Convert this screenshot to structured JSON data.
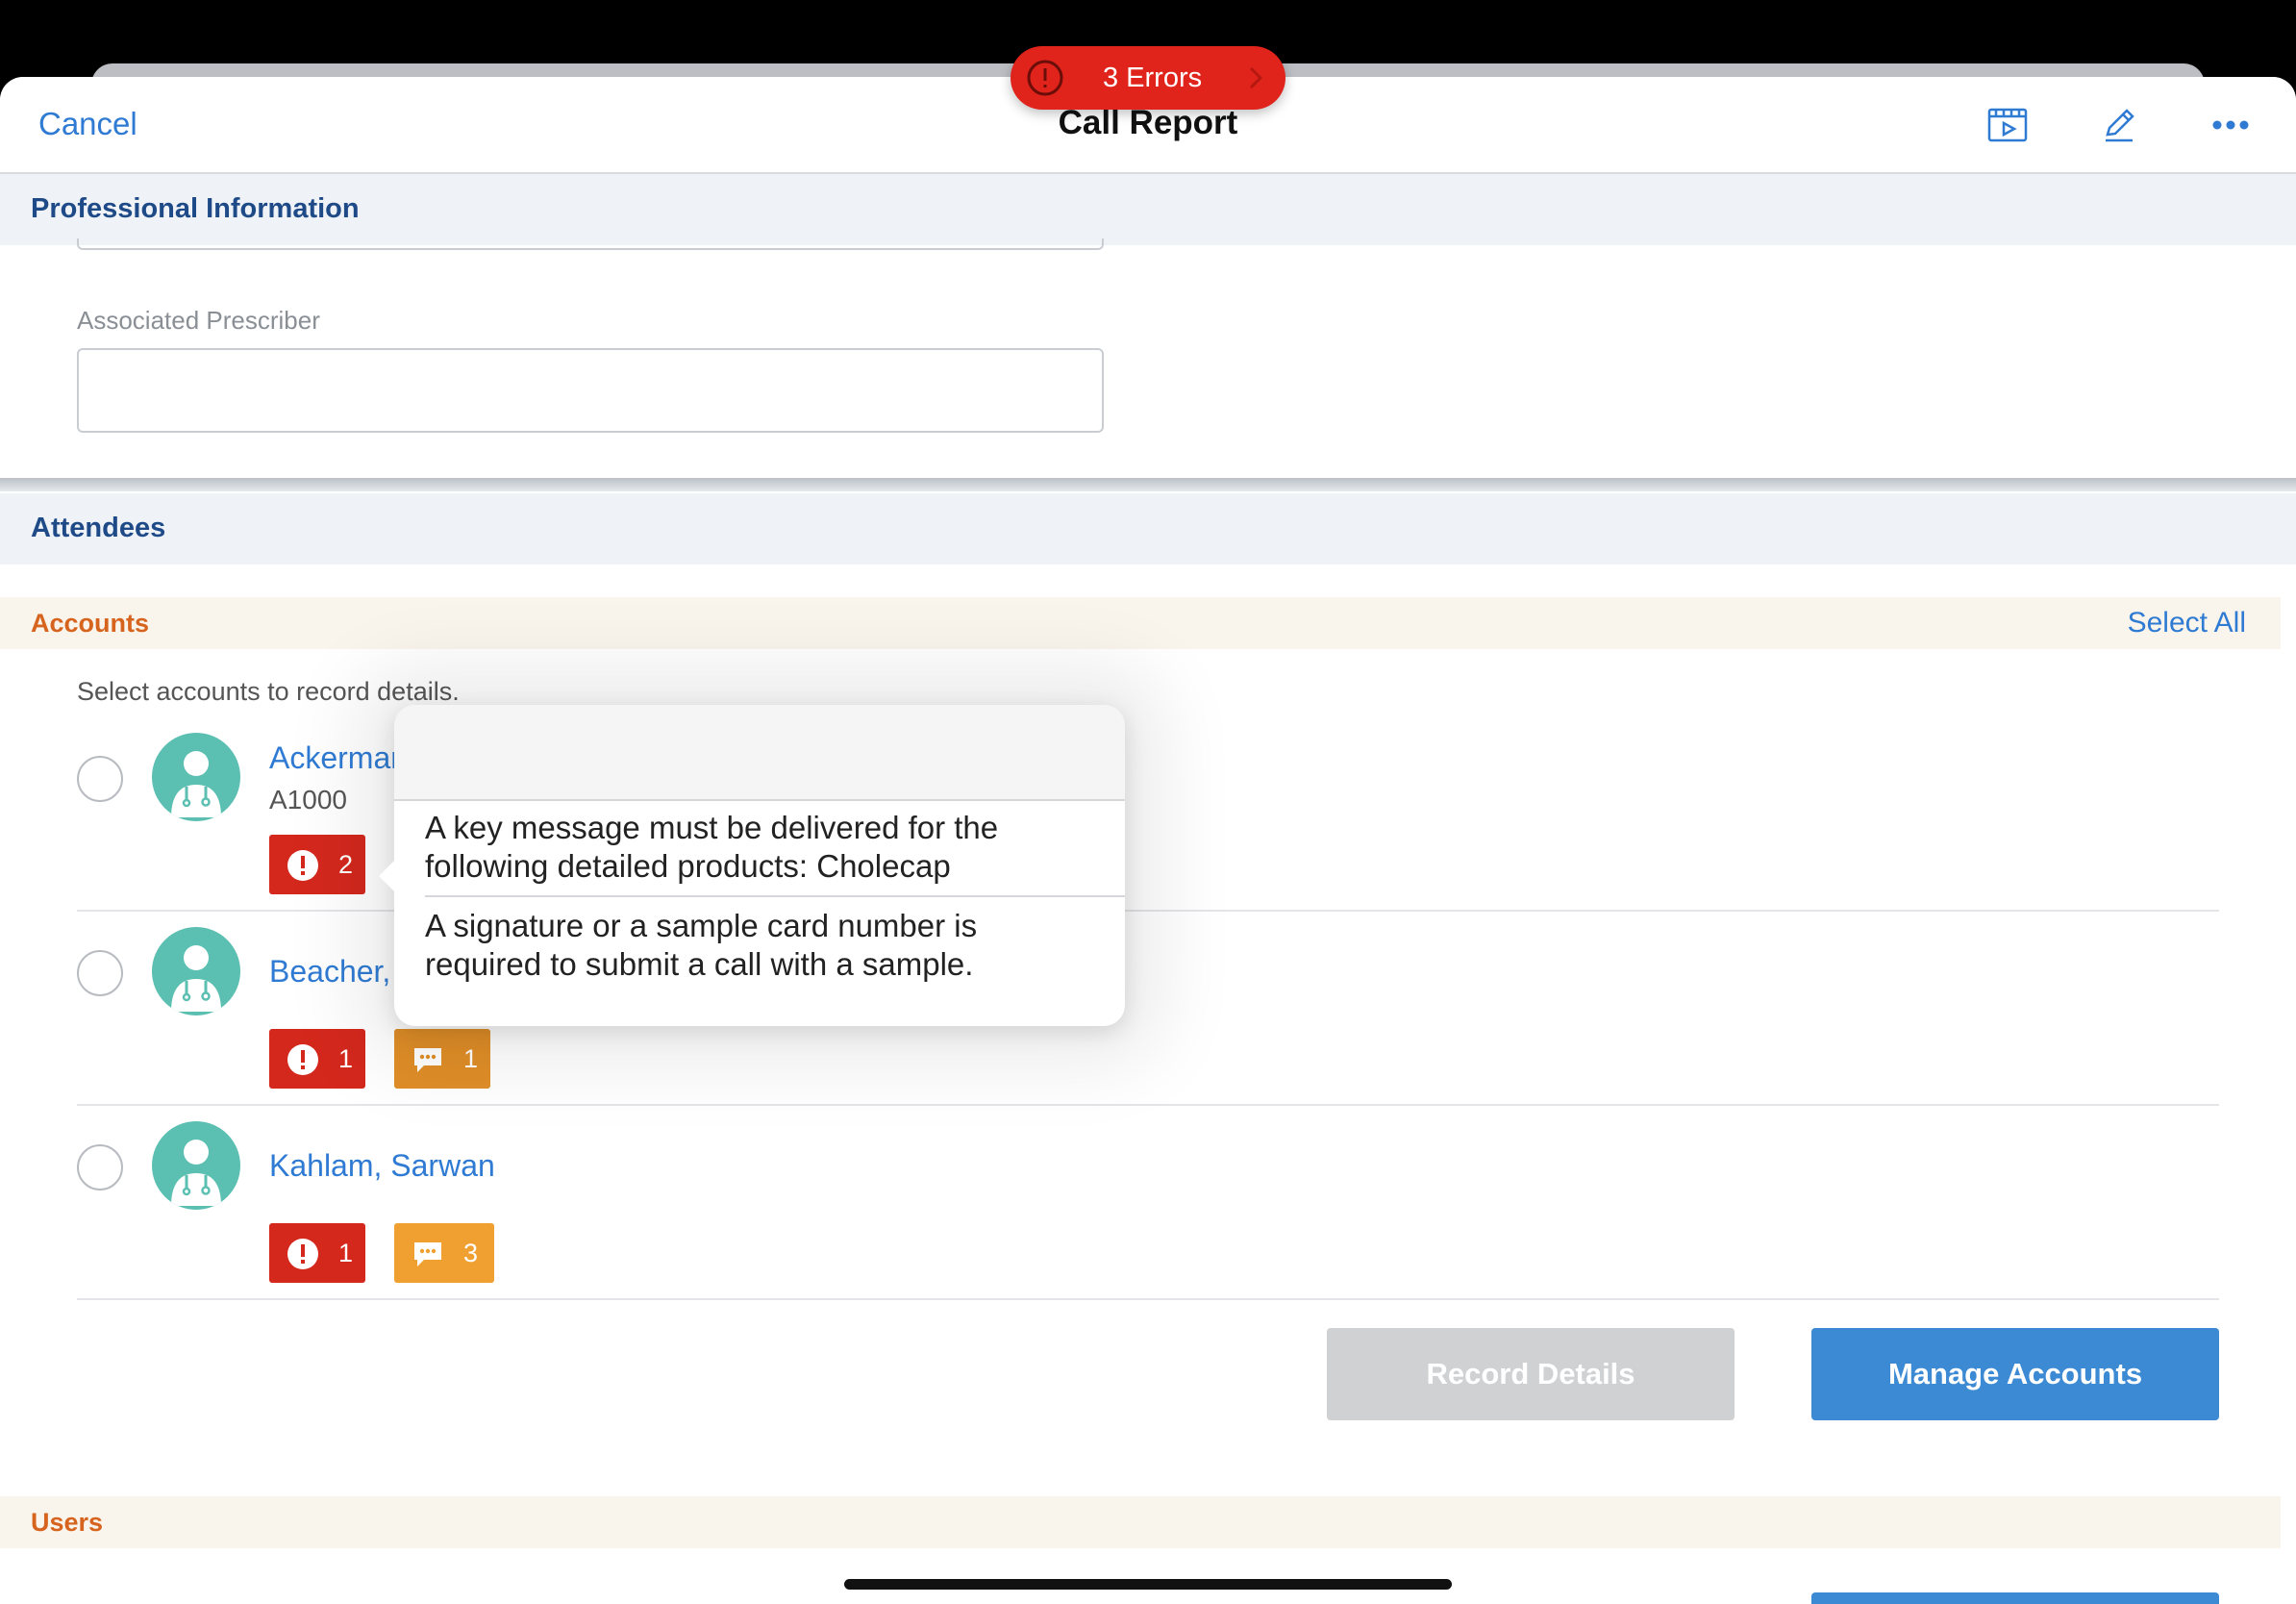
{
  "error_banner": {
    "label": "3 Errors"
  },
  "nav": {
    "cancel_label": "Cancel",
    "title": "Call Report",
    "icons": [
      "media-play-icon",
      "pencil-edit-icon",
      "more-options-icon"
    ]
  },
  "professional_info": {
    "header": "Professional Information",
    "associated_prescriber_label": "Associated Prescriber",
    "associated_prescriber_value": ""
  },
  "attendees": {
    "header": "Attendees",
    "accounts": {
      "title": "Accounts",
      "select_all_label": "Select All",
      "hint": "Select accounts to record details.",
      "items": [
        {
          "name": "Ackerman",
          "id": "A1000",
          "error_count": "2",
          "message_count": ""
        },
        {
          "name": "Beacher,",
          "id": "",
          "error_count": "1",
          "message_count": "1"
        },
        {
          "name": "Kahlam, Sarwan",
          "id": "",
          "error_count": "1",
          "message_count": "3"
        }
      ],
      "record_details_label": "Record Details",
      "manage_accounts_label": "Manage Accounts"
    },
    "users": {
      "title": "Users"
    }
  },
  "popover": {
    "messages": [
      "A key message must be delivered for the following detailed products: Cholecap",
      "A signature or a sample card number is required to submit a call with a sample."
    ]
  },
  "colors": {
    "accent_blue": "#2f7bd3",
    "error_red": "#d4281d",
    "warning_orange": "#f0a030",
    "section_title": "#1f4a88",
    "subsection_title": "#d7641e",
    "avatar_teal": "#5bbfb1"
  }
}
